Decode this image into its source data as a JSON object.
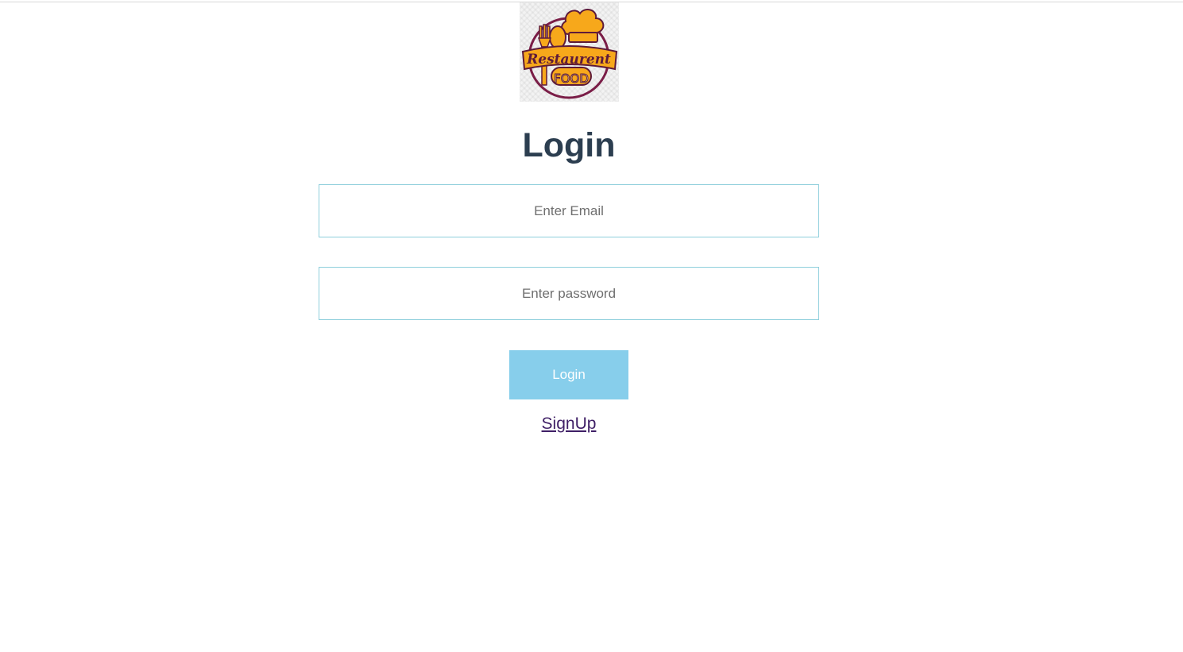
{
  "logo": {
    "line1": "Restaurent",
    "line2": "FOOD",
    "colors": {
      "primary": "#f7a81b",
      "outline": "#5e1b3a",
      "ring": "#7a1d47"
    }
  },
  "page_title": "Login",
  "form": {
    "email": {
      "value": "",
      "placeholder": "Enter Email"
    },
    "password": {
      "value": "",
      "placeholder": "Enter password"
    },
    "submit_label": "Login",
    "signup_link": "SignUp"
  },
  "colors": {
    "title": "#2c3e50",
    "field_border": "#8fcfdc",
    "button_bg": "#87ceeb",
    "button_text": "#ffffff",
    "link": "#3f1f66"
  }
}
